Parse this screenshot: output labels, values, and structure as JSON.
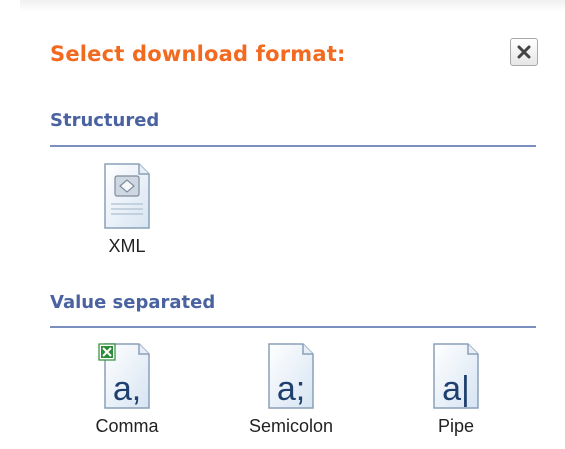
{
  "dialog": {
    "title": "Select download format:",
    "close_icon": "close-icon"
  },
  "sections": {
    "structured": {
      "title": "Structured",
      "items": [
        {
          "label": "XML",
          "icon": "xml-file-icon"
        }
      ]
    },
    "value_separated": {
      "title": "Value separated",
      "items": [
        {
          "label": "Comma",
          "icon": "comma-separated-file-icon",
          "glyph": "a,"
        },
        {
          "label": "Semicolon",
          "icon": "semicolon-separated-file-icon",
          "glyph": "a;"
        },
        {
          "label": "Pipe",
          "icon": "pipe-separated-file-icon",
          "glyph": "a|"
        }
      ]
    }
  },
  "colors": {
    "title": "#f26a1f",
    "section_title": "#4a63a0",
    "section_rule": "#7b8fbf",
    "excel_badge": "#2e8b3a"
  }
}
